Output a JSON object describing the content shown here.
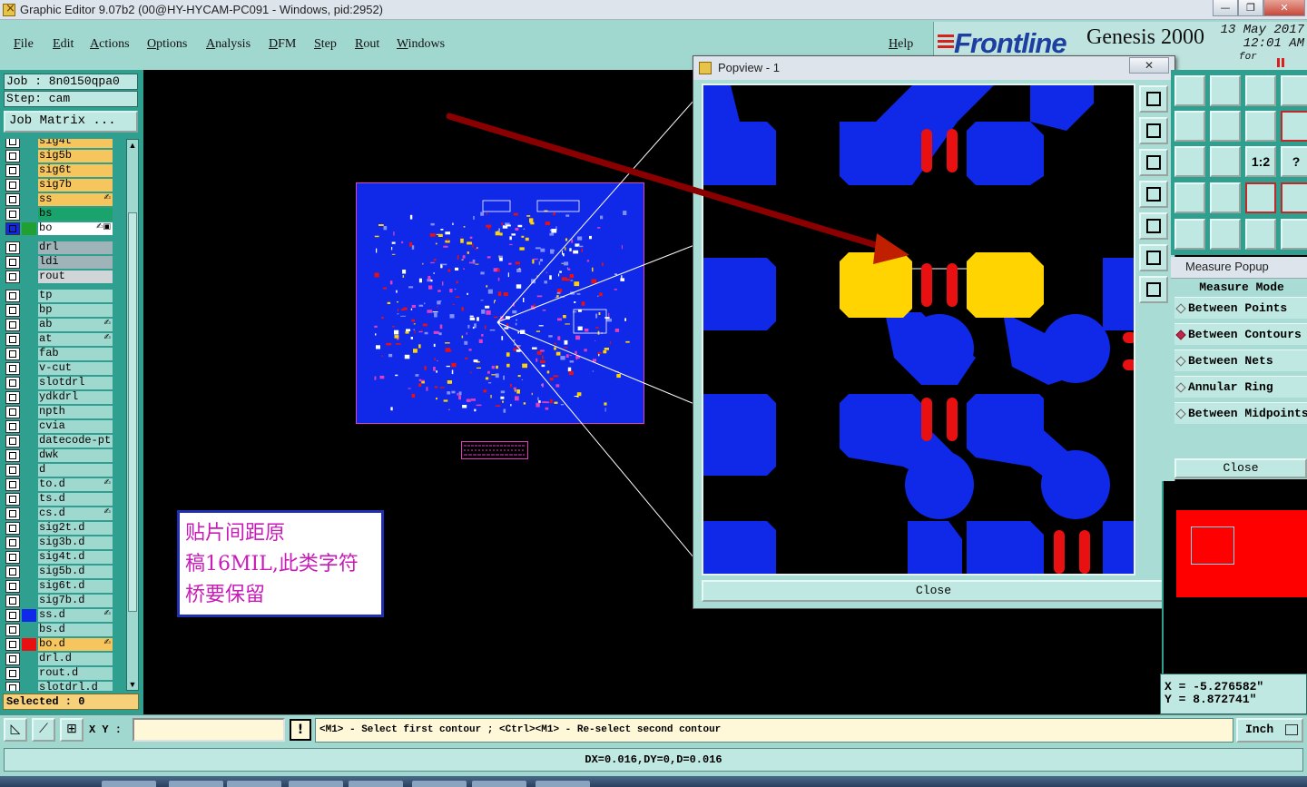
{
  "window": {
    "title": "Graphic Editor 9.07b2 (00@HY-HYCAM-PC091 - Windows, pid:2952)",
    "minimize": "—",
    "maximize": "❐",
    "close": "✕"
  },
  "menu": {
    "items": [
      "File",
      "Edit",
      "Actions",
      "Options",
      "Analysis",
      "DFM",
      "Step",
      "Rout",
      "Windows"
    ],
    "help": "Help"
  },
  "brand": {
    "logo": "Frontline",
    "product": "Genesis 2000",
    "date": "13 May 2017",
    "time": "12:01 AM",
    "subtext": "for"
  },
  "job": {
    "job_line": "Job : 8n0150qpa0",
    "step_line": "Step: cam",
    "matrix_button": "Job Matrix ..."
  },
  "layers": [
    {
      "name": "sig4t",
      "color": "#f7c55e",
      "mark": ""
    },
    {
      "name": "sig5b",
      "color": "#f7c55e",
      "mark": ""
    },
    {
      "name": "sig6t",
      "color": "#f7c55e",
      "mark": ""
    },
    {
      "name": "sig7b",
      "color": "#f7c55e",
      "mark": ""
    },
    {
      "name": "ss",
      "color": "#f7c55e",
      "mark": "✍"
    },
    {
      "name": "bs",
      "color": "#1aa36a",
      "mark": ""
    },
    {
      "name": "bo",
      "color": "#ffffff",
      "mark": "✍▣",
      "swatch": "#20a030",
      "active": true
    },
    {
      "name": "drl",
      "color": "#9fb4b8",
      "mark": ""
    },
    {
      "name": "ldi",
      "color": "#9fb4b8",
      "mark": ""
    },
    {
      "name": "rout",
      "color": "#d0d6d8",
      "mark": ""
    },
    {
      "name": "tp",
      "color": "#9fd8cf",
      "mark": ""
    },
    {
      "name": "bp",
      "color": "#9fd8cf",
      "mark": ""
    },
    {
      "name": "ab",
      "color": "#9fd8cf",
      "mark": "✍"
    },
    {
      "name": "at",
      "color": "#9fd8cf",
      "mark": "✍"
    },
    {
      "name": "fab",
      "color": "#9fd8cf",
      "mark": ""
    },
    {
      "name": "v-cut",
      "color": "#9fd8cf",
      "mark": ""
    },
    {
      "name": "slotdrl",
      "color": "#9fd8cf",
      "mark": ""
    },
    {
      "name": "ydkdrl",
      "color": "#9fd8cf",
      "mark": ""
    },
    {
      "name": "npth",
      "color": "#9fd8cf",
      "mark": ""
    },
    {
      "name": "cvia",
      "color": "#9fd8cf",
      "mark": ""
    },
    {
      "name": "datecode-pt",
      "color": "#9fd8cf",
      "mark": ""
    },
    {
      "name": "dwk",
      "color": "#9fd8cf",
      "mark": ""
    },
    {
      "name": "d",
      "color": "#9fd8cf",
      "mark": ""
    },
    {
      "name": "to.d",
      "color": "#9fd8cf",
      "mark": "✍"
    },
    {
      "name": "ts.d",
      "color": "#9fd8cf",
      "mark": ""
    },
    {
      "name": "cs.d",
      "color": "#9fd8cf",
      "mark": "✍"
    },
    {
      "name": "sig2t.d",
      "color": "#9fd8cf",
      "mark": ""
    },
    {
      "name": "sig3b.d",
      "color": "#9fd8cf",
      "mark": ""
    },
    {
      "name": "sig4t.d",
      "color": "#9fd8cf",
      "mark": ""
    },
    {
      "name": "sig5b.d",
      "color": "#9fd8cf",
      "mark": ""
    },
    {
      "name": "sig6t.d",
      "color": "#9fd8cf",
      "mark": ""
    },
    {
      "name": "sig7b.d",
      "color": "#9fd8cf",
      "mark": ""
    },
    {
      "name": "ss.d",
      "color": "#9fd8cf",
      "mark": "✍",
      "swatch": "#1028e8"
    },
    {
      "name": "bs.d",
      "color": "#9fd8cf",
      "mark": ""
    },
    {
      "name": "bo.d",
      "color": "#f7c55e",
      "mark": "✍",
      "swatch": "#e81010"
    },
    {
      "name": "drl.d",
      "color": "#9fd8cf",
      "mark": ""
    },
    {
      "name": "rout.d",
      "color": "#9fd8cf",
      "mark": ""
    },
    {
      "name": "slotdrl.d",
      "color": "#9fd8cf",
      "mark": ""
    }
  ],
  "selected": "Selected : 0",
  "annotation": {
    "lines": [
      "贴片间距原",
      "稿16MIL,此类字符",
      "桥要保留"
    ]
  },
  "popview": {
    "title": "Popview - 1",
    "close_x": "✕",
    "close_button": "Close"
  },
  "right_tools": [
    "",
    "",
    "",
    "",
    "",
    "",
    "",
    "",
    "",
    "",
    "1:2",
    "?",
    "",
    "",
    "",
    "",
    "",
    "",
    "",
    ""
  ],
  "measure": {
    "title": "Measure Popup",
    "mode_label": "Measure Mode",
    "options": [
      "Between Points",
      "Between Contours",
      "Between Nets",
      "Annular Ring",
      "Between Midpoints"
    ],
    "selected_option": "Between Contours",
    "close": "Close"
  },
  "coords": {
    "x": "X = -5.276582\"",
    "y": "Y = 8.872741\""
  },
  "bottom": {
    "xy_label": "X Y :",
    "xy_value": "",
    "exclamation": "!",
    "prompt": "<M1> - Select first contour ; <Ctrl><M1> - Re-select second contour",
    "unit": "Inch"
  },
  "status": "DX=0.016,DY=0,D=0.016",
  "colors": {
    "panel": "#a0d8d0",
    "layer_board": "#1028e8",
    "pad_yellow": "#ffd400",
    "silk_red": "#e81010",
    "arrow": "#8a0000"
  }
}
